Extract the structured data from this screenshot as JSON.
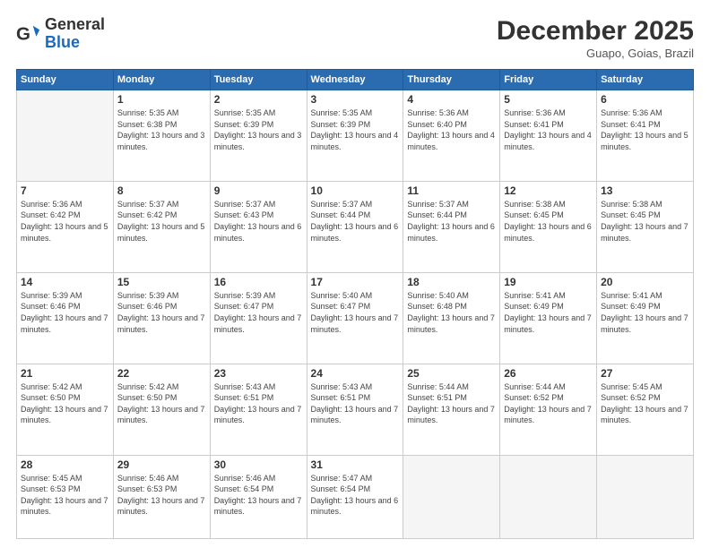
{
  "header": {
    "logo": {
      "general": "General",
      "blue": "Blue"
    },
    "title": "December 2025",
    "location": "Guapo, Goias, Brazil"
  },
  "weekdays": [
    "Sunday",
    "Monday",
    "Tuesday",
    "Wednesday",
    "Thursday",
    "Friday",
    "Saturday"
  ],
  "weeks": [
    [
      {
        "day": null,
        "sunrise": null,
        "sunset": null,
        "daylight": null
      },
      {
        "day": "1",
        "sunrise": "Sunrise: 5:35 AM",
        "sunset": "Sunset: 6:38 PM",
        "daylight": "Daylight: 13 hours and 3 minutes."
      },
      {
        "day": "2",
        "sunrise": "Sunrise: 5:35 AM",
        "sunset": "Sunset: 6:39 PM",
        "daylight": "Daylight: 13 hours and 3 minutes."
      },
      {
        "day": "3",
        "sunrise": "Sunrise: 5:35 AM",
        "sunset": "Sunset: 6:39 PM",
        "daylight": "Daylight: 13 hours and 4 minutes."
      },
      {
        "day": "4",
        "sunrise": "Sunrise: 5:36 AM",
        "sunset": "Sunset: 6:40 PM",
        "daylight": "Daylight: 13 hours and 4 minutes."
      },
      {
        "day": "5",
        "sunrise": "Sunrise: 5:36 AM",
        "sunset": "Sunset: 6:41 PM",
        "daylight": "Daylight: 13 hours and 4 minutes."
      },
      {
        "day": "6",
        "sunrise": "Sunrise: 5:36 AM",
        "sunset": "Sunset: 6:41 PM",
        "daylight": "Daylight: 13 hours and 5 minutes."
      }
    ],
    [
      {
        "day": "7",
        "sunrise": "Sunrise: 5:36 AM",
        "sunset": "Sunset: 6:42 PM",
        "daylight": "Daylight: 13 hours and 5 minutes."
      },
      {
        "day": "8",
        "sunrise": "Sunrise: 5:37 AM",
        "sunset": "Sunset: 6:42 PM",
        "daylight": "Daylight: 13 hours and 5 minutes."
      },
      {
        "day": "9",
        "sunrise": "Sunrise: 5:37 AM",
        "sunset": "Sunset: 6:43 PM",
        "daylight": "Daylight: 13 hours and 6 minutes."
      },
      {
        "day": "10",
        "sunrise": "Sunrise: 5:37 AM",
        "sunset": "Sunset: 6:44 PM",
        "daylight": "Daylight: 13 hours and 6 minutes."
      },
      {
        "day": "11",
        "sunrise": "Sunrise: 5:37 AM",
        "sunset": "Sunset: 6:44 PM",
        "daylight": "Daylight: 13 hours and 6 minutes."
      },
      {
        "day": "12",
        "sunrise": "Sunrise: 5:38 AM",
        "sunset": "Sunset: 6:45 PM",
        "daylight": "Daylight: 13 hours and 6 minutes."
      },
      {
        "day": "13",
        "sunrise": "Sunrise: 5:38 AM",
        "sunset": "Sunset: 6:45 PM",
        "daylight": "Daylight: 13 hours and 7 minutes."
      }
    ],
    [
      {
        "day": "14",
        "sunrise": "Sunrise: 5:39 AM",
        "sunset": "Sunset: 6:46 PM",
        "daylight": "Daylight: 13 hours and 7 minutes."
      },
      {
        "day": "15",
        "sunrise": "Sunrise: 5:39 AM",
        "sunset": "Sunset: 6:46 PM",
        "daylight": "Daylight: 13 hours and 7 minutes."
      },
      {
        "day": "16",
        "sunrise": "Sunrise: 5:39 AM",
        "sunset": "Sunset: 6:47 PM",
        "daylight": "Daylight: 13 hours and 7 minutes."
      },
      {
        "day": "17",
        "sunrise": "Sunrise: 5:40 AM",
        "sunset": "Sunset: 6:47 PM",
        "daylight": "Daylight: 13 hours and 7 minutes."
      },
      {
        "day": "18",
        "sunrise": "Sunrise: 5:40 AM",
        "sunset": "Sunset: 6:48 PM",
        "daylight": "Daylight: 13 hours and 7 minutes."
      },
      {
        "day": "19",
        "sunrise": "Sunrise: 5:41 AM",
        "sunset": "Sunset: 6:49 PM",
        "daylight": "Daylight: 13 hours and 7 minutes."
      },
      {
        "day": "20",
        "sunrise": "Sunrise: 5:41 AM",
        "sunset": "Sunset: 6:49 PM",
        "daylight": "Daylight: 13 hours and 7 minutes."
      }
    ],
    [
      {
        "day": "21",
        "sunrise": "Sunrise: 5:42 AM",
        "sunset": "Sunset: 6:50 PM",
        "daylight": "Daylight: 13 hours and 7 minutes."
      },
      {
        "day": "22",
        "sunrise": "Sunrise: 5:42 AM",
        "sunset": "Sunset: 6:50 PM",
        "daylight": "Daylight: 13 hours and 7 minutes."
      },
      {
        "day": "23",
        "sunrise": "Sunrise: 5:43 AM",
        "sunset": "Sunset: 6:51 PM",
        "daylight": "Daylight: 13 hours and 7 minutes."
      },
      {
        "day": "24",
        "sunrise": "Sunrise: 5:43 AM",
        "sunset": "Sunset: 6:51 PM",
        "daylight": "Daylight: 13 hours and 7 minutes."
      },
      {
        "day": "25",
        "sunrise": "Sunrise: 5:44 AM",
        "sunset": "Sunset: 6:51 PM",
        "daylight": "Daylight: 13 hours and 7 minutes."
      },
      {
        "day": "26",
        "sunrise": "Sunrise: 5:44 AM",
        "sunset": "Sunset: 6:52 PM",
        "daylight": "Daylight: 13 hours and 7 minutes."
      },
      {
        "day": "27",
        "sunrise": "Sunrise: 5:45 AM",
        "sunset": "Sunset: 6:52 PM",
        "daylight": "Daylight: 13 hours and 7 minutes."
      }
    ],
    [
      {
        "day": "28",
        "sunrise": "Sunrise: 5:45 AM",
        "sunset": "Sunset: 6:53 PM",
        "daylight": "Daylight: 13 hours and 7 minutes."
      },
      {
        "day": "29",
        "sunrise": "Sunrise: 5:46 AM",
        "sunset": "Sunset: 6:53 PM",
        "daylight": "Daylight: 13 hours and 7 minutes."
      },
      {
        "day": "30",
        "sunrise": "Sunrise: 5:46 AM",
        "sunset": "Sunset: 6:54 PM",
        "daylight": "Daylight: 13 hours and 7 minutes."
      },
      {
        "day": "31",
        "sunrise": "Sunrise: 5:47 AM",
        "sunset": "Sunset: 6:54 PM",
        "daylight": "Daylight: 13 hours and 6 minutes."
      },
      {
        "day": null,
        "sunrise": null,
        "sunset": null,
        "daylight": null
      },
      {
        "day": null,
        "sunrise": null,
        "sunset": null,
        "daylight": null
      },
      {
        "day": null,
        "sunrise": null,
        "sunset": null,
        "daylight": null
      }
    ]
  ]
}
